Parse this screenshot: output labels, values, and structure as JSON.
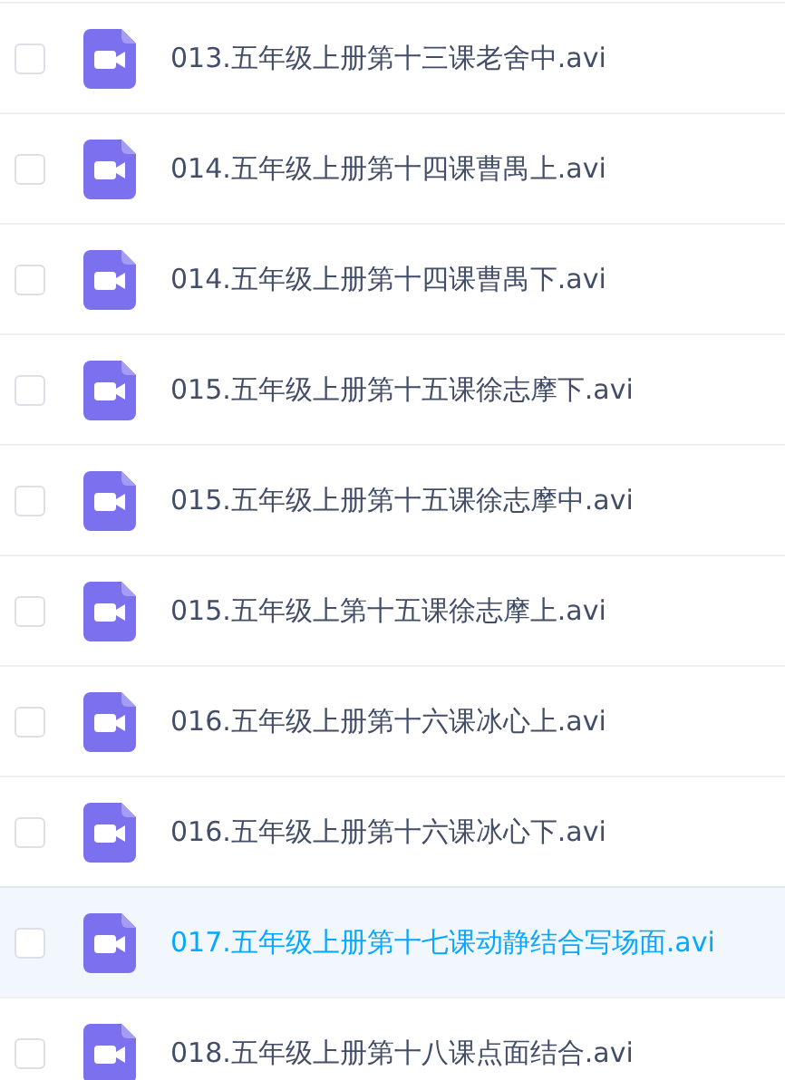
{
  "files": [
    {
      "name": "013.五年级上册第十三课老舍中.avi",
      "checked": false,
      "highlighted": false
    },
    {
      "name": "014.五年级上册第十四课曹禺上.avi",
      "checked": false,
      "highlighted": false
    },
    {
      "name": "014.五年级上册第十四课曹禺下.avi",
      "checked": false,
      "highlighted": false
    },
    {
      "name": "015.五年级上册第十五课徐志摩下.avi",
      "checked": false,
      "highlighted": false
    },
    {
      "name": "015.五年级上册第十五课徐志摩中.avi",
      "checked": false,
      "highlighted": false
    },
    {
      "name": "015.五年级上第十五课徐志摩上.avi",
      "checked": false,
      "highlighted": false
    },
    {
      "name": "016.五年级上册第十六课冰心上.avi",
      "checked": false,
      "highlighted": false
    },
    {
      "name": "016.五年级上册第十六课冰心下.avi",
      "checked": false,
      "highlighted": false
    },
    {
      "name": "017.五年级上册第十七课动静结合写场面.avi",
      "checked": false,
      "highlighted": true
    },
    {
      "name": "018.五年级上册第十八课点面结合.avi",
      "checked": false,
      "highlighted": false
    }
  ]
}
